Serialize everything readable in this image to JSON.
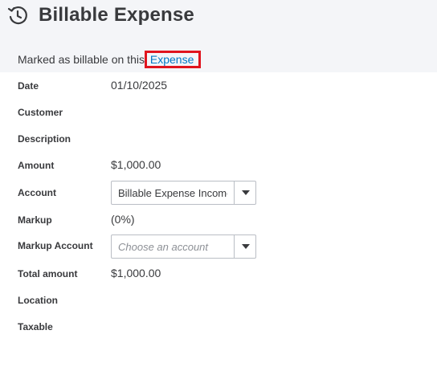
{
  "header": {
    "title": "Billable Expense",
    "subtitle_prefix": "Marked as billable on this",
    "subtitle_link": "Expense",
    "icon": "history-clock-icon"
  },
  "fields": {
    "date": {
      "label": "Date",
      "value": "01/10/2025"
    },
    "customer": {
      "label": "Customer",
      "value": ""
    },
    "description": {
      "label": "Description",
      "value": ""
    },
    "amount": {
      "label": "Amount",
      "value": "$1,000.00"
    },
    "account": {
      "label": "Account",
      "value": "Billable Expense Income"
    },
    "markup": {
      "label": "Markup",
      "value": "(0%)"
    },
    "markup_account": {
      "label": "Markup Account",
      "placeholder": "Choose an account"
    },
    "total_amount": {
      "label": "Total amount",
      "value": "$1,000.00"
    },
    "location": {
      "label": "Location",
      "value": ""
    },
    "taxable": {
      "label": "Taxable",
      "value": ""
    }
  },
  "colors": {
    "link": "#0077c5",
    "highlight_border": "#e0141e",
    "header_bg": "#f4f5f8"
  }
}
